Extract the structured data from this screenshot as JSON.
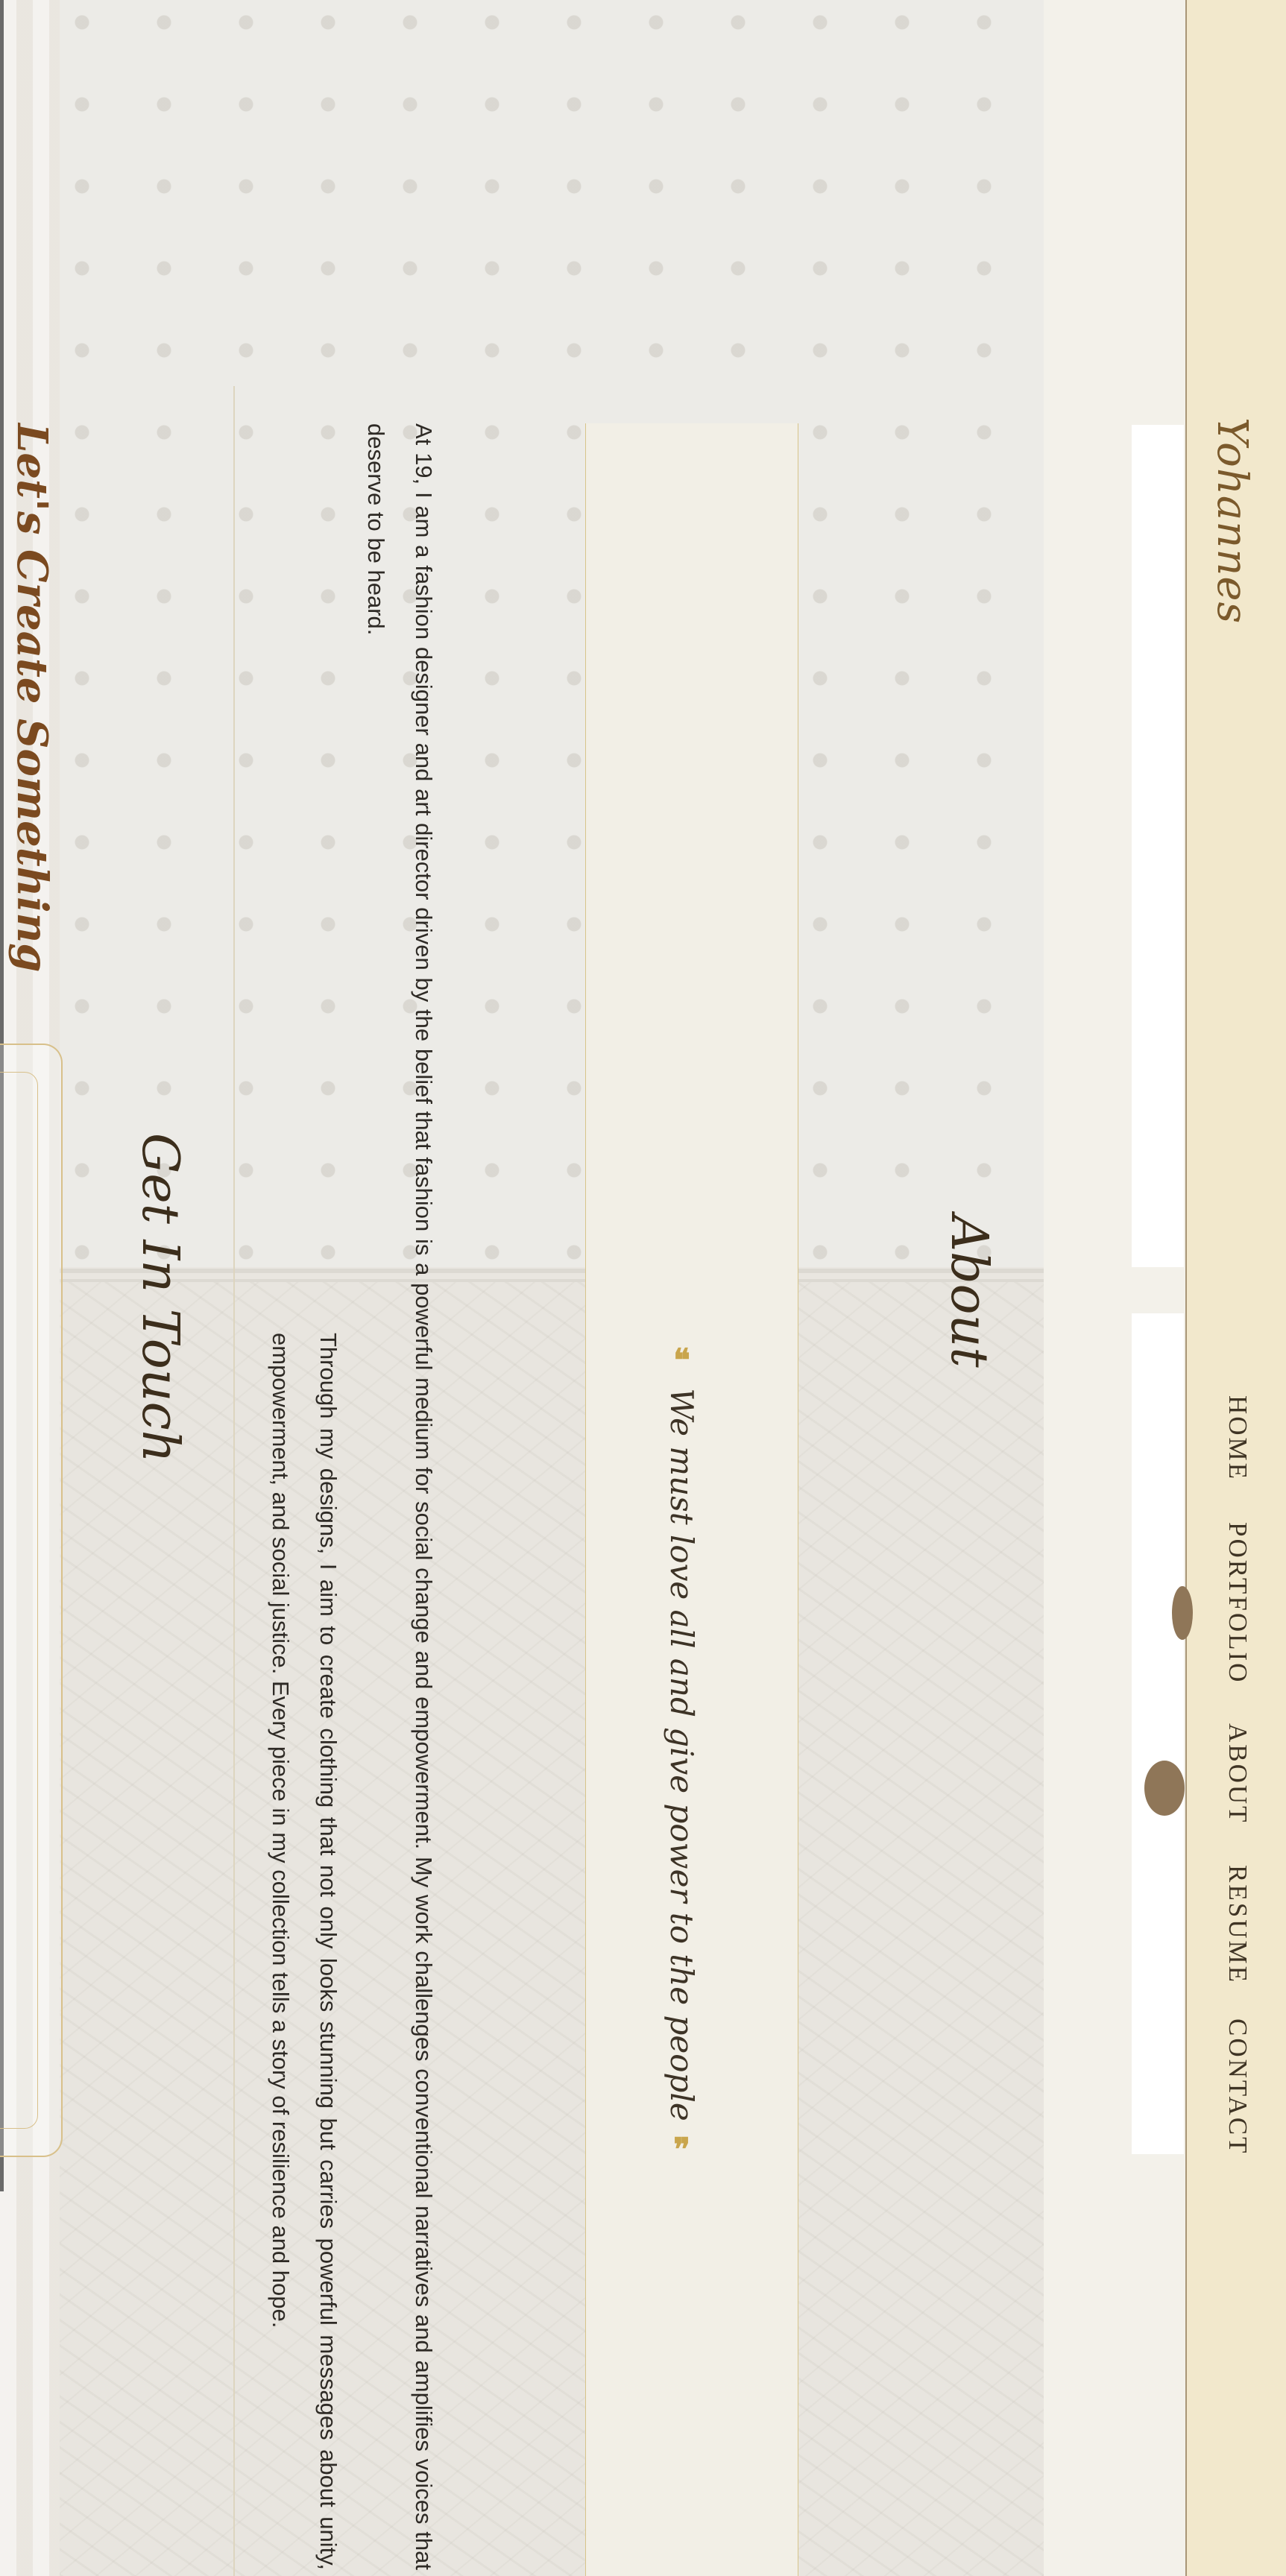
{
  "header": {
    "logo": "Yohannes",
    "nav": [
      {
        "label": "HOME"
      },
      {
        "label": "PORTFOLIO"
      },
      {
        "label": "ABOUT"
      },
      {
        "label": "RESUME"
      },
      {
        "label": "CONTACT"
      }
    ]
  },
  "about": {
    "title": "About",
    "quote_open": "❝",
    "quote": "We must love all and give power to the people",
    "quote_close": "❞",
    "paragraphs": [
      "At 19, I am a fashion designer and art director driven by the belief that fashion is a powerful medium for social change and empowerment. My work challenges conventional narratives and amplifies voices that deserve to be heard.",
      "Through my designs, I aim to create clothing that not only looks stunning but carries powerful messages about unity, empowerment, and social justice. Every piece in my collection tells a story of resilience and hope."
    ]
  },
  "contact": {
    "title": "Get In Touch",
    "heading": "Let's Create Something"
  },
  "colors": {
    "accent_gold": "#c9a54c",
    "header_bg": "#f2e8cc",
    "text_dark": "#3c2e1c",
    "heading_brown": "#7b4a20"
  }
}
